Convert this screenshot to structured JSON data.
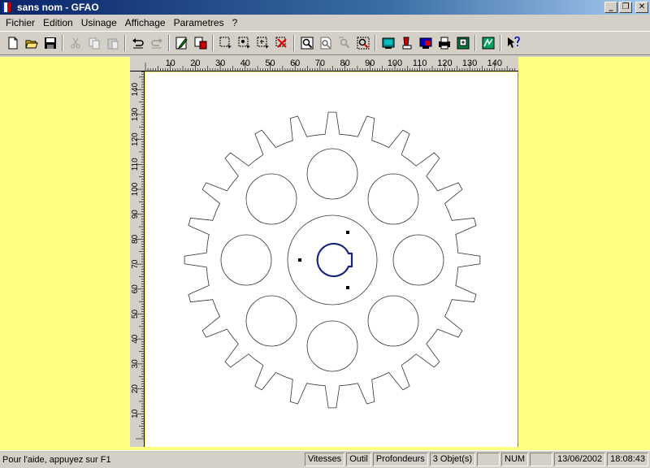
{
  "window": {
    "title": "sans nom - GFAO",
    "minimize_label": "_",
    "restore_label": "❐",
    "close_label": "✕"
  },
  "menu": [
    "Fichier",
    "Edition",
    "Usinage",
    "Affichage",
    "Parametres",
    "?"
  ],
  "toolbar": {
    "icons": [
      "new-file-icon",
      "open-folder-icon",
      "save-icon",
      "cut-icon",
      "copy-icon",
      "paste-icon",
      "undo-icon",
      "redo-icon",
      "draw-pencil-icon",
      "select-shape-icon",
      "select-rect-icon",
      "select-points-icon",
      "select-move-icon",
      "delete-icon",
      "zoom-icon",
      "zoom-page-icon",
      "zoom-out-icon",
      "zoom-all-icon",
      "machine-icon",
      "tool-icon",
      "simulate-icon",
      "print-icon",
      "export-icon",
      "calculator-icon",
      "help-pointer-icon"
    ]
  },
  "rulers": {
    "top_labels": [
      "10",
      "20",
      "30",
      "40",
      "50",
      "60",
      "70",
      "80",
      "90",
      "100",
      "110",
      "120",
      "130",
      "140"
    ],
    "left_labels": [
      "140",
      "130",
      "120",
      "110",
      "100",
      "90",
      "80",
      "70",
      "60",
      "50",
      "40",
      "30",
      "20",
      "10"
    ]
  },
  "colors": {
    "workspace": "#ffff80",
    "outline": "#333333",
    "keyway": "#1a237e",
    "canvas": "#ffffff"
  },
  "status": {
    "message": "Pour l'aide, appuyez sur F1",
    "vitesses": "Vitesses",
    "outil": "Outil",
    "profondeurs": "Profondeurs",
    "objets": "3 Objet(s)",
    "empty1": "",
    "num": "NUM",
    "empty2": "",
    "date": "13/06/2002",
    "time": "18:08:43"
  }
}
